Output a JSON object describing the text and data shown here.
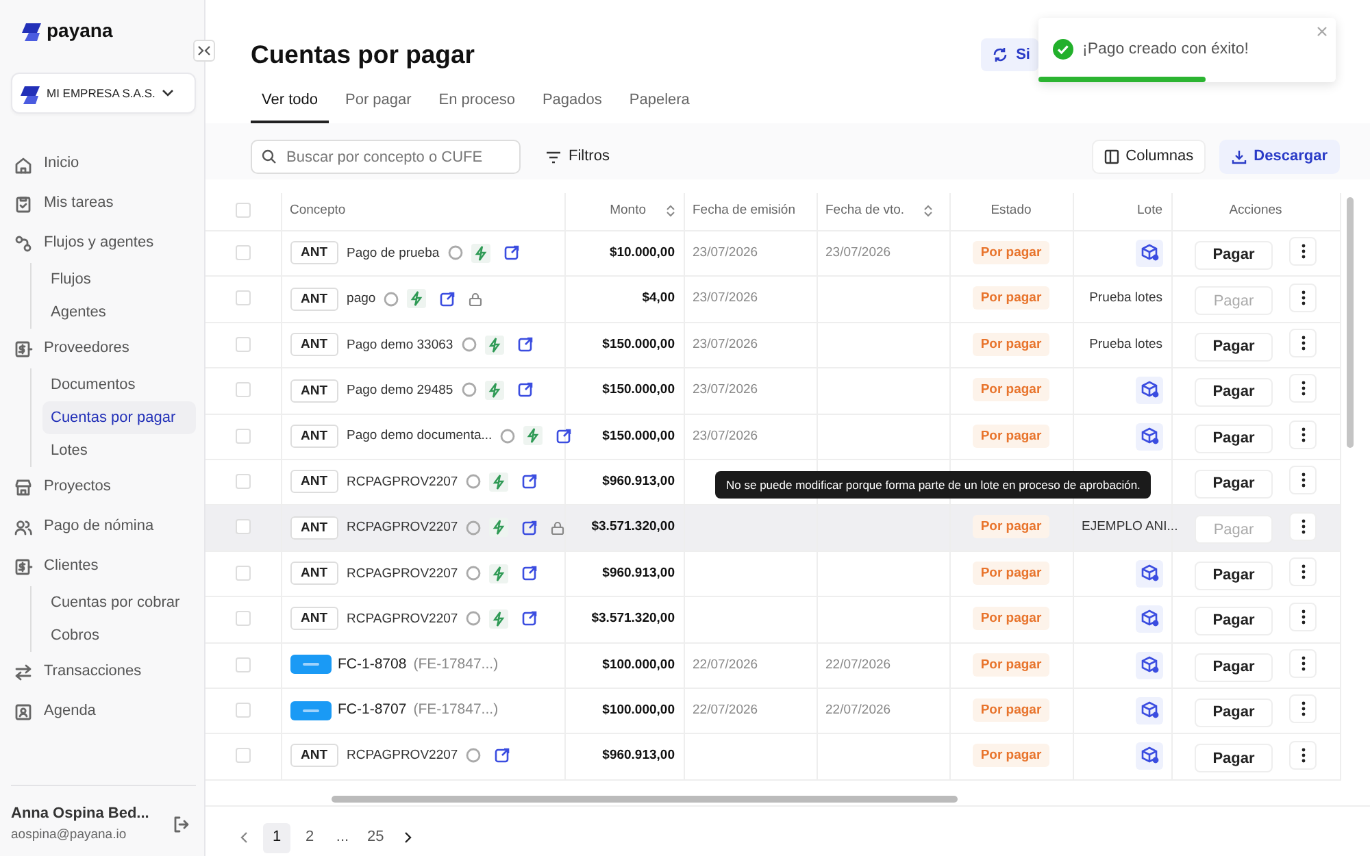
{
  "brand": "payana",
  "company": "MI EMPRESA S.A.S.",
  "sidebar": {
    "items": [
      {
        "label": "Inicio",
        "selected": false
      },
      {
        "label": "Mis tareas",
        "selected": false
      },
      {
        "label": "Flujos y agentes",
        "selected": false,
        "children": [
          {
            "label": "Flujos",
            "selected": false
          },
          {
            "label": "Agentes",
            "selected": false
          }
        ]
      },
      {
        "label": "Proveedores",
        "selected": false,
        "children": [
          {
            "label": "Documentos",
            "selected": false
          },
          {
            "label": "Cuentas por pagar",
            "selected": true
          },
          {
            "label": "Lotes",
            "selected": false
          }
        ]
      },
      {
        "label": "Proyectos",
        "selected": false
      },
      {
        "label": "Pago de nómina",
        "selected": false
      },
      {
        "label": "Clientes",
        "selected": false,
        "children": [
          {
            "label": "Cuentas por cobrar",
            "selected": false
          },
          {
            "label": "Cobros",
            "selected": false
          }
        ]
      },
      {
        "label": "Transacciones",
        "selected": false
      },
      {
        "label": "Agenda",
        "selected": false
      }
    ]
  },
  "user": {
    "name": "Anna Ospina Bed...",
    "email": "aospina@payana.io"
  },
  "page_title": "Cuentas por pagar",
  "sync_button": "Si",
  "toast": {
    "message": "¡Pago creado con éxito!",
    "level": 0.56
  },
  "tabs": [
    {
      "label": "Ver todo",
      "selected": true
    },
    {
      "label": "Por pagar",
      "selected": false
    },
    {
      "label": "En proceso",
      "selected": false
    },
    {
      "label": "Pagados",
      "selected": false
    },
    {
      "label": "Papelera",
      "selected": false
    }
  ],
  "search": {
    "placeholder": "Buscar por concepto o CUFE"
  },
  "filters_button": "Filtros",
  "columns_button": "Columnas",
  "download_button": "Descargar",
  "table": {
    "select_all_checked": false,
    "columns": [
      {
        "label": "Concepto",
        "sortable": false
      },
      {
        "label": "Monto",
        "sortable": true
      },
      {
        "label": "Fecha de emisión",
        "sortable": false
      },
      {
        "label": "Fecha de vto.",
        "sortable": true
      },
      {
        "label": "Estado",
        "sortable": false
      },
      {
        "label": "Lote",
        "sortable": false
      },
      {
        "label": "Acciones",
        "sortable": false
      }
    ],
    "rows": [
      {
        "checked": false,
        "kind": "ant",
        "tag": "ANT",
        "concept": "Pago de prueba",
        "automated": true,
        "locked": false,
        "amount": "$10.000,00",
        "issued": "23/07/2026",
        "due": "23/07/2026",
        "status": "Por pagar",
        "batch": "",
        "pay": "Pagar",
        "pay_disabled": false,
        "highlighted": false
      },
      {
        "checked": false,
        "kind": "ant",
        "tag": "ANT",
        "concept": "pago",
        "automated": true,
        "locked": true,
        "amount": "$4,00",
        "issued": "23/07/2026",
        "due": "",
        "status": "Por pagar",
        "batch": "Prueba lotes",
        "pay": "Pagar",
        "pay_disabled": true,
        "highlighted": false
      },
      {
        "checked": false,
        "kind": "ant",
        "tag": "ANT",
        "concept": "Pago demo 33063",
        "automated": true,
        "locked": false,
        "amount": "$150.000,00",
        "issued": "23/07/2026",
        "due": "",
        "status": "Por pagar",
        "batch": "Prueba lotes",
        "pay": "Pagar",
        "pay_disabled": false,
        "highlighted": false
      },
      {
        "checked": false,
        "kind": "ant",
        "tag": "ANT",
        "concept": "Pago demo 29485",
        "automated": true,
        "locked": false,
        "amount": "$150.000,00",
        "issued": "23/07/2026",
        "due": "",
        "status": "Por pagar",
        "batch": "",
        "pay": "Pagar",
        "pay_disabled": false,
        "highlighted": false
      },
      {
        "checked": false,
        "kind": "ant",
        "tag": "ANT",
        "concept": "Pago demo documenta...",
        "automated": true,
        "locked": false,
        "amount": "$150.000,00",
        "issued": "23/07/2026",
        "due": "",
        "status": "Por pagar",
        "batch": "",
        "pay": "Pagar",
        "pay_disabled": false,
        "highlighted": false
      },
      {
        "checked": false,
        "kind": "ant",
        "tag": "ANT",
        "concept": "RCPAGPROV2207",
        "automated": true,
        "locked": false,
        "amount": "$960.913,00",
        "issued": "",
        "due": "",
        "status": "",
        "batch": "",
        "pay": "Pagar",
        "pay_disabled": false,
        "highlighted": false,
        "tooltip": "No se puede modificar porque forma parte de un lote en proceso de aprobación."
      },
      {
        "checked": false,
        "kind": "ant",
        "tag": "ANT",
        "concept": "RCPAGPROV2207",
        "automated": true,
        "locked": true,
        "amount": "$3.571.320,00",
        "issued": "",
        "due": "",
        "status": "Por pagar",
        "batch": "EJEMPLO ANI...",
        "pay": "Pagar",
        "pay_disabled": true,
        "highlighted": true
      },
      {
        "checked": false,
        "kind": "ant",
        "tag": "ANT",
        "concept": "RCPAGPROV2207",
        "automated": true,
        "locked": false,
        "amount": "$960.913,00",
        "issued": "",
        "due": "",
        "status": "Por pagar",
        "batch": "",
        "pay": "Pagar",
        "pay_disabled": false,
        "highlighted": false
      },
      {
        "checked": false,
        "kind": "ant",
        "tag": "ANT",
        "concept": "RCPAGPROV2207",
        "automated": true,
        "locked": false,
        "amount": "$3.571.320,00",
        "issued": "",
        "due": "",
        "status": "Por pagar",
        "batch": "",
        "pay": "Pagar",
        "pay_disabled": false,
        "highlighted": false
      },
      {
        "checked": false,
        "kind": "invoice",
        "concept": "FC-1-8708",
        "reference": "(FE-17847...)",
        "amount": "$100.000,00",
        "issued": "22/07/2026",
        "due": "22/07/2026",
        "status": "Por pagar",
        "batch": "",
        "pay": "Pagar",
        "pay_disabled": false,
        "highlighted": false
      },
      {
        "checked": false,
        "kind": "invoice",
        "concept": "FC-1-8707",
        "reference": "(FE-17847...)",
        "amount": "$100.000,00",
        "issued": "22/07/2026",
        "due": "22/07/2026",
        "status": "Por pagar",
        "batch": "",
        "pay": "Pagar",
        "pay_disabled": false,
        "highlighted": false
      },
      {
        "checked": false,
        "kind": "ant",
        "tag": "ANT",
        "concept": "RCPAGPROV2207",
        "automated": false,
        "locked": false,
        "amount": "$960.913,00",
        "issued": "",
        "due": "",
        "status": "Por pagar",
        "batch": "",
        "pay": "Pagar",
        "pay_disabled": false,
        "highlighted": false
      }
    ]
  },
  "pagination": [
    {
      "label": "1",
      "selected": true
    },
    {
      "label": "2",
      "selected": false
    },
    {
      "label": "...",
      "selected": false
    },
    {
      "label": "25",
      "selected": false
    }
  ]
}
